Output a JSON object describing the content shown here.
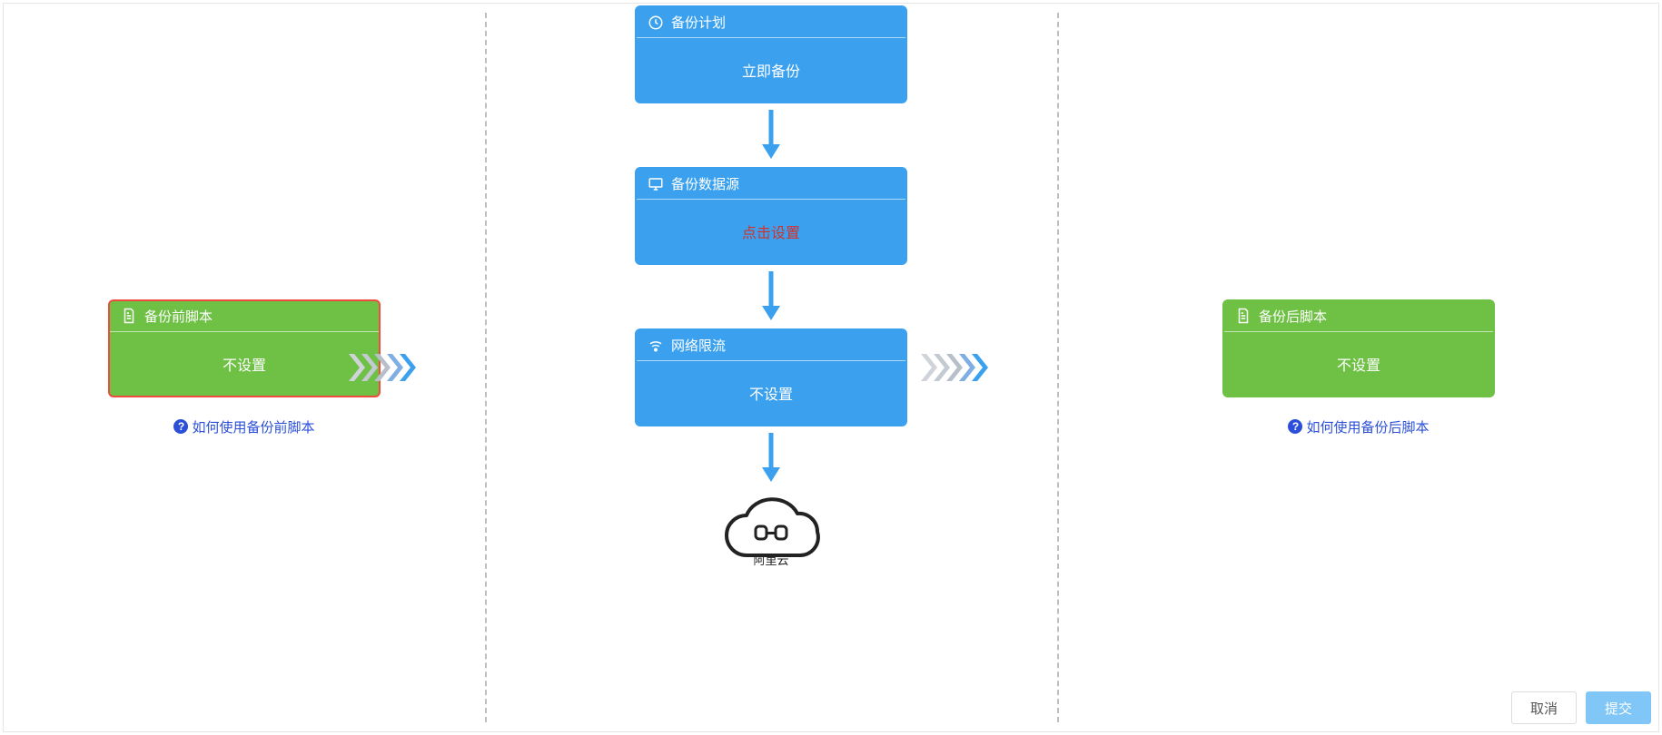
{
  "left": {
    "title": "备份前脚本",
    "body": "不设置",
    "help": "如何使用备份前脚本"
  },
  "mid": {
    "plan": {
      "title": "备份计划",
      "body": "立即备份"
    },
    "source": {
      "title": "备份数据源",
      "body": "点击设置"
    },
    "limit": {
      "title": "网络限流",
      "body": "不设置"
    },
    "cloud_label": "阿里云"
  },
  "right": {
    "title": "备份后脚本",
    "body": "不设置",
    "help": "如何使用备份后脚本"
  },
  "footer": {
    "cancel": "取消",
    "submit": "提交"
  }
}
